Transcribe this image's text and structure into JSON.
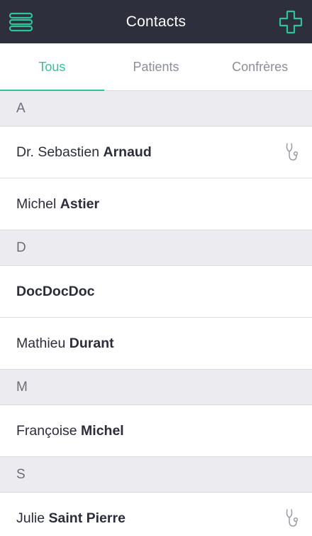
{
  "header": {
    "title": "Contacts"
  },
  "tabs": [
    {
      "label": "Tous",
      "active": true
    },
    {
      "label": "Patients",
      "active": false
    },
    {
      "label": "Confrères",
      "active": false
    }
  ],
  "sections": [
    {
      "letter": "A",
      "contacts": [
        {
          "first": "Dr. Sebastien",
          "last": "Arnaud",
          "icon": "stethoscope-icon"
        },
        {
          "first": "Michel",
          "last": "Astier"
        }
      ]
    },
    {
      "letter": "D",
      "contacts": [
        {
          "first": "",
          "last": "DocDocDoc"
        },
        {
          "first": "Mathieu",
          "last": "Durant"
        }
      ]
    },
    {
      "letter": "M",
      "contacts": [
        {
          "first": "Françoise",
          "last": "Michel"
        }
      ]
    },
    {
      "letter": "S",
      "contacts": [
        {
          "first": "Julie",
          "last": "Saint Pierre",
          "icon": "stethoscope-icon"
        }
      ]
    }
  ],
  "colors": {
    "header_bg": "#2d2f3c",
    "accent": "#2fc39a",
    "section_bg": "#ebebf0"
  },
  "icons": {
    "menu": "hamburger-menu-icon",
    "add": "plus-icon",
    "doctor_badge": "stethoscope-icon"
  }
}
